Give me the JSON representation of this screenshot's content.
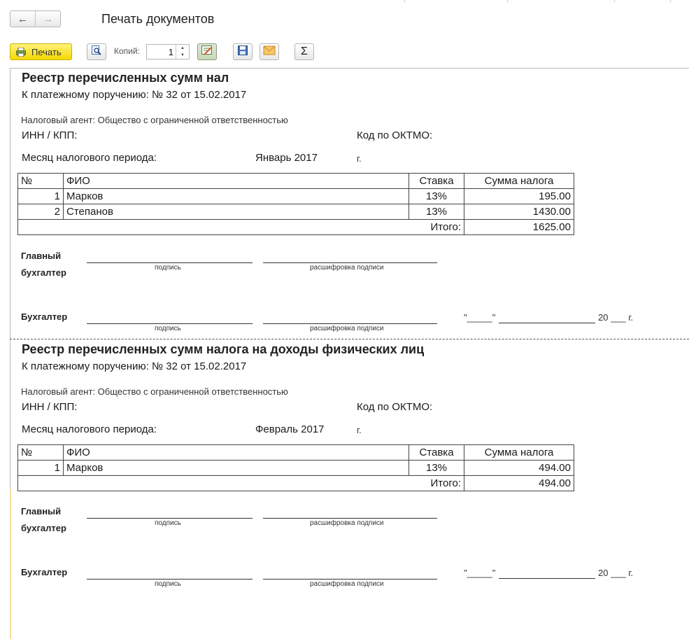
{
  "window": {
    "title": "Печать документов"
  },
  "toolbar": {
    "print_label": "Печать",
    "copies_label": "Копий:",
    "copies_value": "1",
    "sum_symbol": "Σ"
  },
  "reports": [
    {
      "title": "Реестр перечисленных сумм нал",
      "payment": "К платежному поручению: № 32 от 15.02.2017",
      "agent": "Налоговый агент: Общество с ограниченной ответственностью",
      "inn_label": "ИНН / КПП:",
      "oktmo_label": "Код по ОКТМО:",
      "period_label": "Месяц налогового периода:",
      "period_value": "Январь 2017",
      "year_suffix": "г.",
      "headers": [
        "№",
        "ФИО",
        "Ставка",
        "Сумма налога"
      ],
      "rows": [
        {
          "num": "1",
          "name": "Марков",
          "rate": "13%",
          "amount": "195.00"
        },
        {
          "num": "2",
          "name": "Степанов",
          "rate": "13%",
          "amount": "1430.00"
        }
      ],
      "total_label": "Итого:",
      "total_value": "1625.00",
      "chief_line1": "Главный",
      "chief_line2": "бухгалтер",
      "sign_caption": "подпись",
      "decode_caption": "расшифровка подписи",
      "accountant": "Бухгалтер",
      "date_quote": "\"_____\"",
      "date_year": "20 ___ г."
    },
    {
      "title": "Реестр перечисленных сумм налога на доходы физических лиц",
      "payment": "К платежному поручению: № 32 от 15.02.2017",
      "agent": "Налоговый агент: Общество с ограниченной ответственностью",
      "inn_label": "ИНН / КПП:",
      "oktmo_label": "Код по ОКТМО:",
      "period_label": "Месяц налогового периода:",
      "period_value": "Февраль 2017",
      "year_suffix": "г.",
      "headers": [
        "№",
        "ФИО",
        "Ставка",
        "Сумма налога"
      ],
      "rows": [
        {
          "num": "1",
          "name": "Марков",
          "rate": "13%",
          "amount": "494.00"
        }
      ],
      "total_label": "Итого:",
      "total_value": "494.00",
      "chief_line1": "Главный",
      "chief_line2": "бухгалтер",
      "sign_caption": "подпись",
      "decode_caption": "расшифровка подписи",
      "accountant": "Бухгалтер",
      "date_quote": "\"_____\"",
      "date_year": "20 ___ г."
    }
  ],
  "colors": {
    "print_button": "#f4d900",
    "page_border": "#b9b9b9",
    "table_border": "#444444"
  }
}
